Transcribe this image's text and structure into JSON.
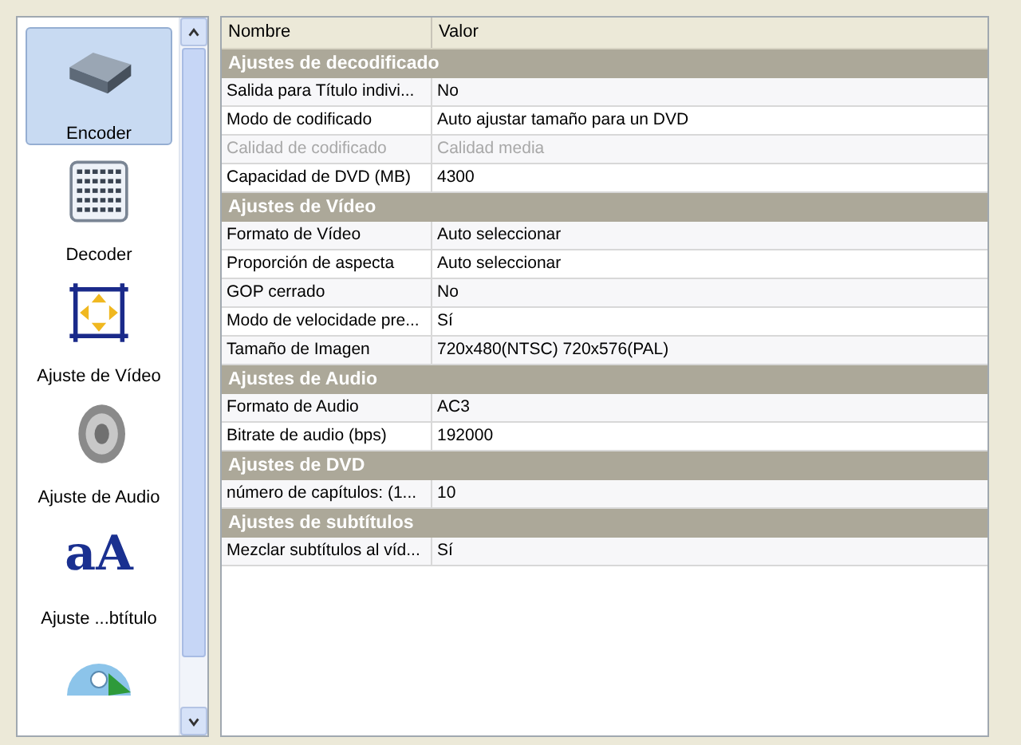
{
  "sidebar": {
    "items": [
      {
        "label": "Encoder",
        "selected": true
      },
      {
        "label": "Decoder",
        "selected": false
      },
      {
        "label": "Ajuste de Vídeo",
        "selected": false
      },
      {
        "label": "Ajuste de Audio",
        "selected": false
      },
      {
        "label": "Ajuste ...btítulo",
        "glyph": "aA",
        "selected": false
      },
      {
        "selected": false
      }
    ]
  },
  "table": {
    "columns": [
      "Nombre",
      "Valor"
    ],
    "rows": [
      {
        "kind": "section",
        "title": "Ajustes de decodificado"
      },
      {
        "kind": "property",
        "name": "Salida para Título indivi...",
        "value": "No",
        "disabled": false
      },
      {
        "kind": "property",
        "name": "Modo de codificado",
        "value": "Auto ajustar tamaño para un DVD",
        "disabled": false
      },
      {
        "kind": "property",
        "name": "Calidad de codificado",
        "value": "Calidad media",
        "disabled": true
      },
      {
        "kind": "property",
        "name": "Capacidad de DVD (MB)",
        "value": "4300",
        "disabled": false
      },
      {
        "kind": "section",
        "title": "Ajustes de Vídeo"
      },
      {
        "kind": "property",
        "name": "Formato de Vídeo",
        "value": "Auto seleccionar",
        "disabled": false
      },
      {
        "kind": "property",
        "name": "Proporción de aspecta",
        "value": "Auto seleccionar",
        "disabled": false
      },
      {
        "kind": "property",
        "name": "GOP cerrado",
        "value": "No",
        "disabled": false
      },
      {
        "kind": "property",
        "name": "Modo de velocidade pre...",
        "value": "Sí",
        "disabled": false
      },
      {
        "kind": "property",
        "name": "Tamaño de Imagen",
        "value": "720x480(NTSC) 720x576(PAL)",
        "disabled": false
      },
      {
        "kind": "section",
        "title": "Ajustes de Audio"
      },
      {
        "kind": "property",
        "name": "Formato de Audio",
        "value": "AC3",
        "disabled": false
      },
      {
        "kind": "property",
        "name": "Bitrate de audio (bps)",
        "value": "192000",
        "disabled": false
      },
      {
        "kind": "section",
        "title": "Ajustes de DVD"
      },
      {
        "kind": "property",
        "name": "número de capítulos: (1...",
        "value": "10",
        "disabled": false
      },
      {
        "kind": "section",
        "title": "Ajustes de subtítulos"
      },
      {
        "kind": "property",
        "name": "Mezclar subtítulos al víd...",
        "value": "Sí",
        "disabled": false
      }
    ]
  }
}
